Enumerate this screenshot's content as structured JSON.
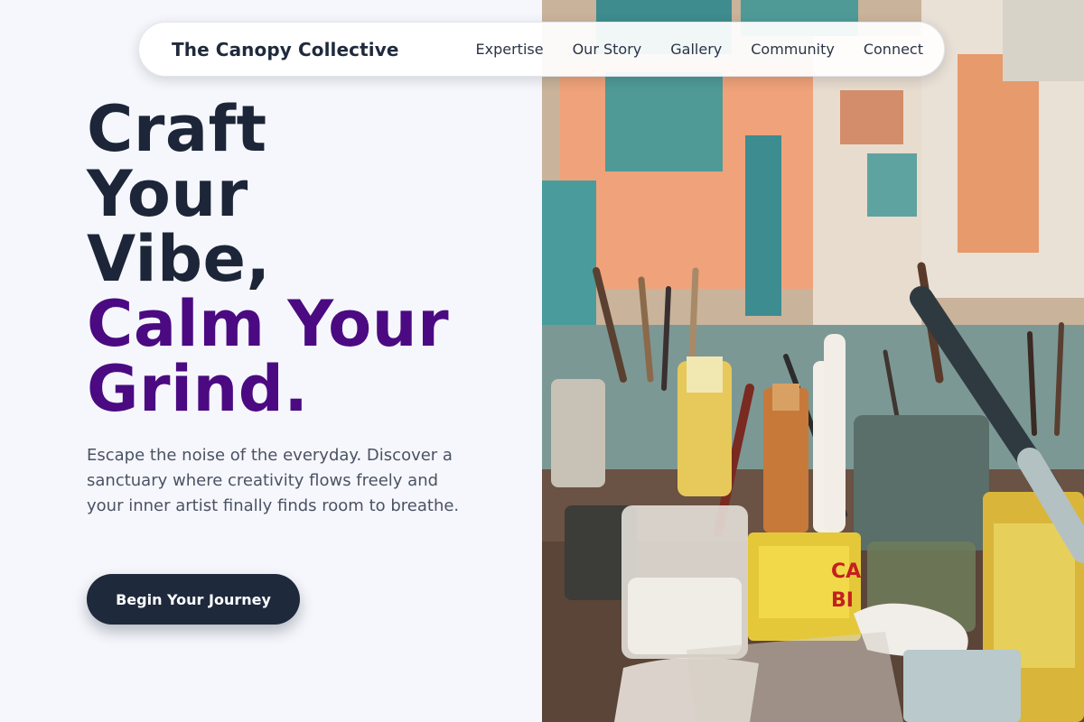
{
  "nav": {
    "brand": "The Canopy Collective",
    "links": [
      "Expertise",
      "Our Story",
      "Gallery",
      "Community",
      "Connect"
    ]
  },
  "hero": {
    "headline_lines": [
      "Craft",
      "Your",
      "Vibe,",
      "Calm Your",
      "Grind."
    ],
    "subtext": "Escape the noise of the everyday. Discover a sanctuary where creativity flows freely and your inner artist finally finds room to breathe.",
    "cta_label": "Begin Your Journey"
  },
  "colors": {
    "heading_dark": "#1c2638",
    "heading_accent": "#4b0a82",
    "button_bg": "#1e293b",
    "page_bg": "#f6f7fc"
  }
}
